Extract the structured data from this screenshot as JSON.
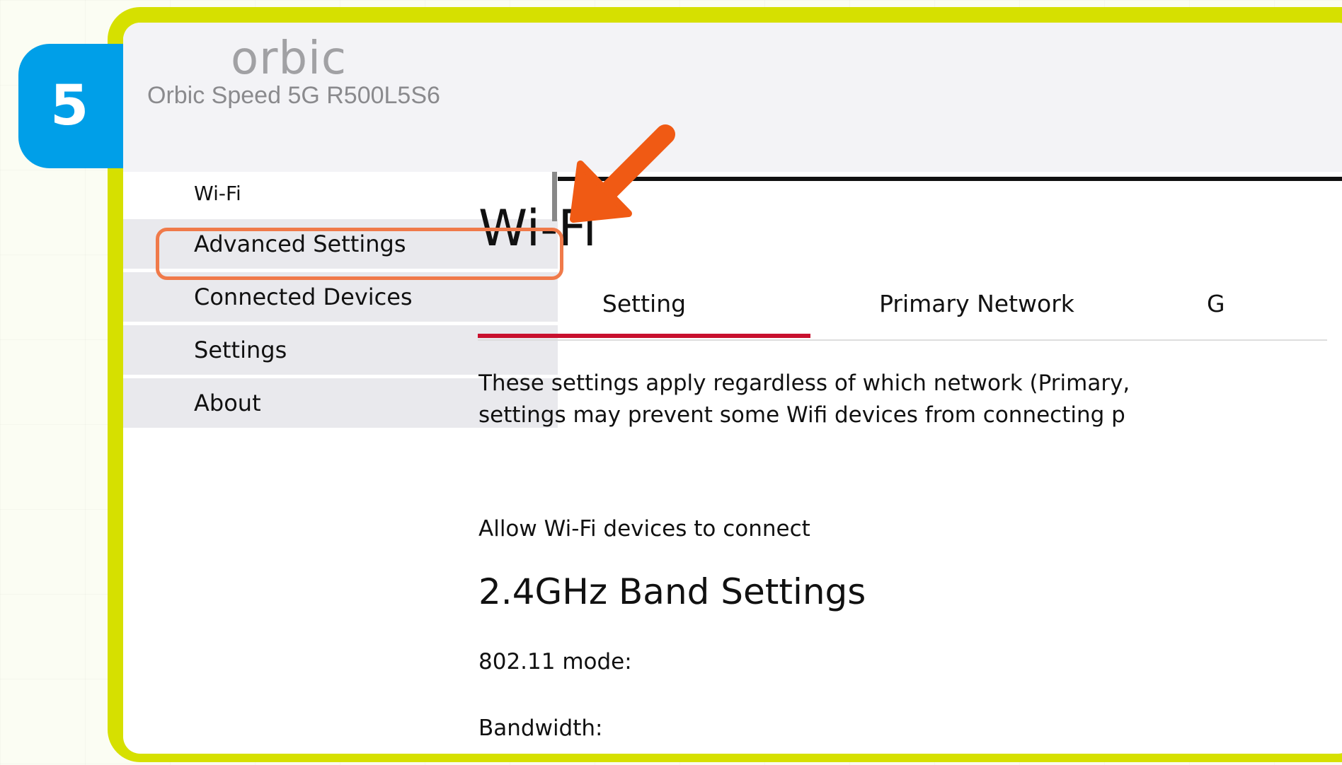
{
  "step": {
    "number": "5"
  },
  "header": {
    "logo_text": "orbic",
    "device_name": "Orbic Speed 5G R500L5S6"
  },
  "sidebar": {
    "items": [
      {
        "label": "Wi-Fi",
        "active": true
      },
      {
        "label": "Advanced Settings",
        "highlighted": true
      },
      {
        "label": "Connected Devices"
      },
      {
        "label": "Settings"
      },
      {
        "label": "About"
      }
    ]
  },
  "main": {
    "title": "Wi-Fi",
    "tabs": [
      {
        "label": "Setting",
        "selected": true
      },
      {
        "label": "Primary Network"
      },
      {
        "label": "G"
      }
    ],
    "description": "These settings apply regardless of which network (Primary,\nsettings may prevent some Wifi devices from connecting p",
    "allow_label": "Allow Wi-Fi devices to connect",
    "band_title": "2.4GHz Band Settings",
    "mode_label": "802.11 mode:",
    "bandwidth_label": "Bandwidth:"
  },
  "colors": {
    "frame": "#d6e000",
    "badge": "#009fe8",
    "arrow": "#f05a14",
    "highlight": "#f07a4a",
    "active_tab": "#c8102e"
  }
}
